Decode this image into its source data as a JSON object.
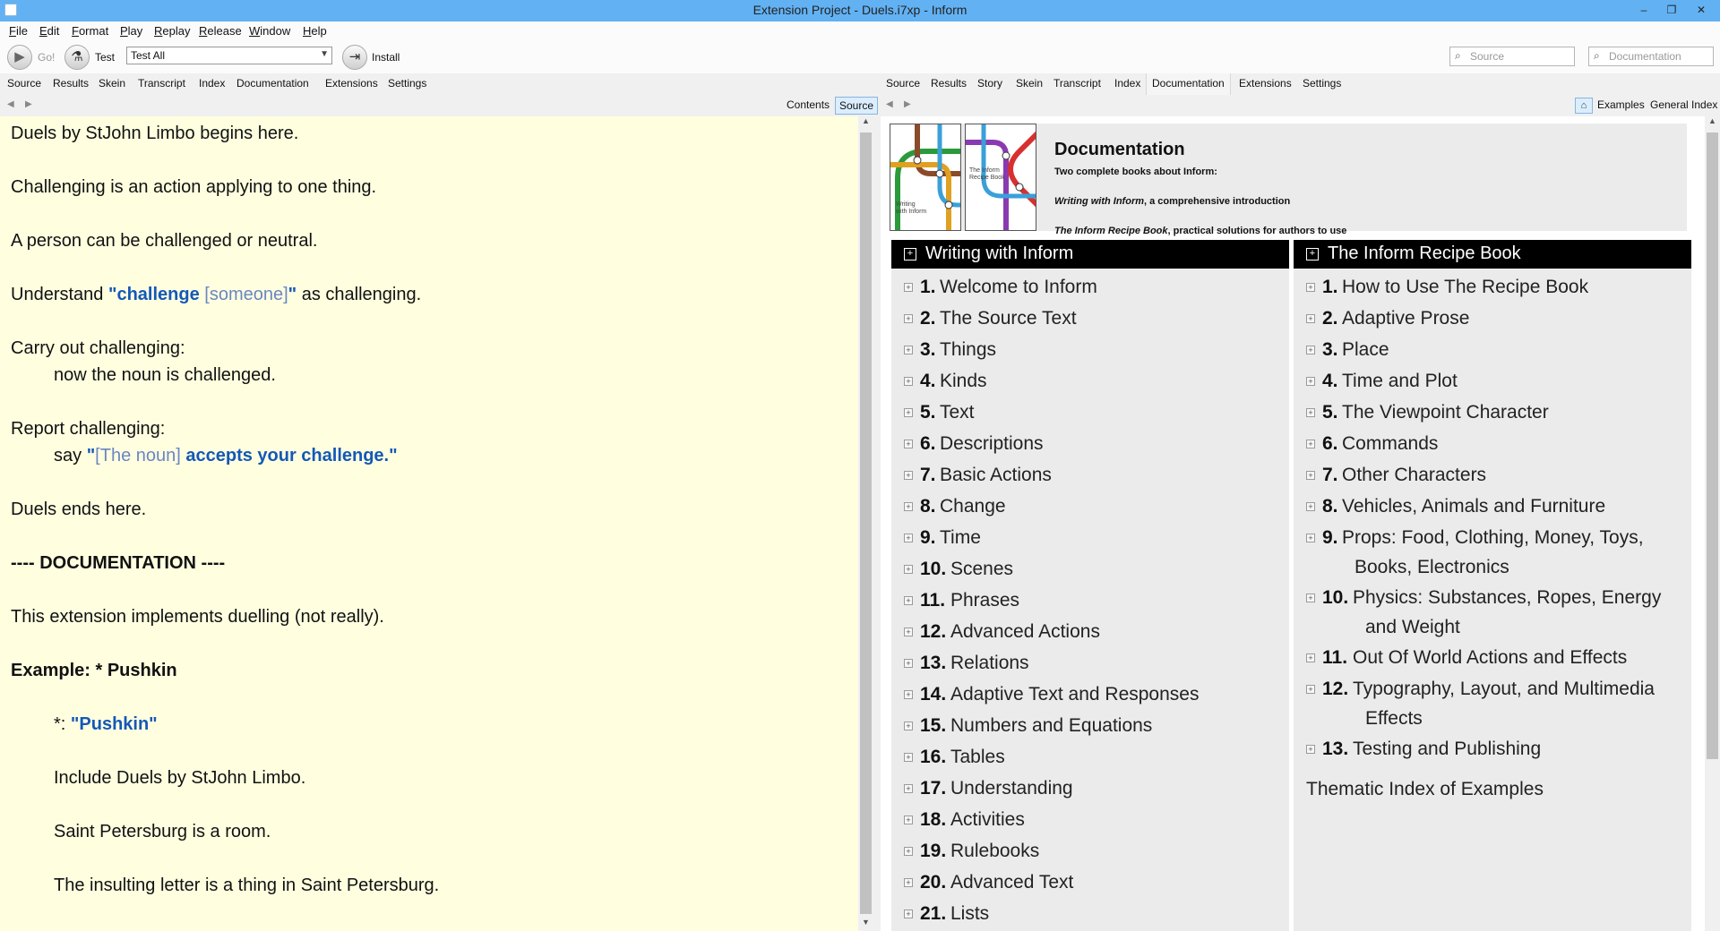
{
  "window": {
    "title": "Extension Project - Duels.i7xp - Inform",
    "minimize": "–",
    "restore": "❐",
    "close": "✕"
  },
  "menu": [
    {
      "u": "F",
      "rest": "ile"
    },
    {
      "u": "E",
      "rest": "dit"
    },
    {
      "u": "F",
      "rest": "ormat"
    },
    {
      "u": "P",
      "rest": "lay"
    },
    {
      "u": "R",
      "rest": "eplay"
    },
    {
      "u": "R",
      "rest": "elease"
    },
    {
      "u": "W",
      "rest": "indow"
    },
    {
      "u": "H",
      "rest": "elp"
    }
  ],
  "toolbar": {
    "go_label": "Go!",
    "test_label": "Test",
    "test_select": "Test All",
    "install_label": "Install",
    "source_search_placeholder": "Source",
    "doc_search_placeholder": "Documentation"
  },
  "left_tabs": [
    "Source",
    "Results",
    "Skein",
    "Transcript",
    "Index",
    "Documentation",
    "Extensions",
    "Settings"
  ],
  "right_tabs": [
    "Source",
    "Results",
    "Story",
    "Skein",
    "Transcript",
    "Index",
    "Documentation",
    "Extensions",
    "Settings"
  ],
  "left_nav": {
    "contents": "Contents",
    "source": "Source"
  },
  "right_nav": {
    "examples": "Examples",
    "general_index": "General Index"
  },
  "source": {
    "l1": "Duels by StJohn Limbo begins here.",
    "l2": "Challenging is an action applying to one thing.",
    "l3": "A person can be challenged or neutral.",
    "l4_a": "Understand ",
    "l4_b": "\"challenge ",
    "l4_c": "[someone]",
    "l4_d": "\"",
    "l4_e": " as challenging.",
    "l5": "Carry out challenging:",
    "l6": "now the noun is challenged.",
    "l7": "Report challenging:",
    "l8_a": "say ",
    "l8_b": "\"",
    "l8_c": "[The noun]",
    "l8_d": " accepts your challenge.\"",
    "l9": "Duels ends here.",
    "l10": "---- DOCUMENTATION ----",
    "l11": "This extension implements duelling (not really).",
    "l12": "Example: * Pushkin",
    "l13_a": "*: ",
    "l13_b": "\"Pushkin\"",
    "l14": "Include Duels by StJohn Limbo.",
    "l15": "Saint Petersburg is a room.",
    "l16": "The insulting letter is a thing in Saint Petersburg."
  },
  "doc": {
    "title": "Documentation",
    "cover1_caption_1": "Writing",
    "cover1_caption_2": "with Inform",
    "cover2_caption_1": "The Inform",
    "cover2_caption_2": "Recipe Book",
    "sub1": "Two complete books about Inform:",
    "sub2_a": "Writing with Inform",
    "sub2_b": ", a comprehensive introduction",
    "sub3_a": "The Inform Recipe Book",
    "sub3_b": ", practical solutions for authors to use",
    "wwi_title": "Writing with Inform",
    "wwi": [
      {
        "n": "1.",
        "t": "Welcome to Inform"
      },
      {
        "n": "2.",
        "t": "The Source Text"
      },
      {
        "n": "3.",
        "t": "Things"
      },
      {
        "n": "4.",
        "t": "Kinds"
      },
      {
        "n": "5.",
        "t": "Text"
      },
      {
        "n": "6.",
        "t": "Descriptions"
      },
      {
        "n": "7.",
        "t": "Basic Actions"
      },
      {
        "n": "8.",
        "t": "Change"
      },
      {
        "n": "9.",
        "t": "Time"
      },
      {
        "n": "10.",
        "t": "Scenes"
      },
      {
        "n": "11.",
        "t": "Phrases"
      },
      {
        "n": "12.",
        "t": "Advanced Actions"
      },
      {
        "n": "13.",
        "t": "Relations"
      },
      {
        "n": "14.",
        "t": "Adaptive Text and Responses"
      },
      {
        "n": "15.",
        "t": "Numbers and Equations"
      },
      {
        "n": "16.",
        "t": "Tables"
      },
      {
        "n": "17.",
        "t": "Understanding"
      },
      {
        "n": "18.",
        "t": "Activities"
      },
      {
        "n": "19.",
        "t": "Rulebooks"
      },
      {
        "n": "20.",
        "t": "Advanced Text"
      },
      {
        "n": "21.",
        "t": "Lists"
      }
    ],
    "rb_title": "The Inform Recipe Book",
    "rb": [
      {
        "n": "1.",
        "t": "How to Use The Recipe Book"
      },
      {
        "n": "2.",
        "t": "Adaptive Prose"
      },
      {
        "n": "3.",
        "t": "Place"
      },
      {
        "n": "4.",
        "t": "Time and Plot"
      },
      {
        "n": "5.",
        "t": "The Viewpoint Character"
      },
      {
        "n": "6.",
        "t": "Commands"
      },
      {
        "n": "7.",
        "t": "Other Characters"
      },
      {
        "n": "8.",
        "t": "Vehicles, Animals and Furniture"
      },
      {
        "n": "9.",
        "t": "Props: Food, Clothing, Money, Toys,",
        "t2": "Books, Electronics"
      },
      {
        "n": "10.",
        "t": "Physics: Substances, Ropes, Energy",
        "t2": "and Weight"
      },
      {
        "n": "11.",
        "t": "Out Of World Actions and Effects"
      },
      {
        "n": "12.",
        "t": "Typography, Layout, and Multimedia",
        "t2": "Effects"
      },
      {
        "n": "13.",
        "t": "Testing and Publishing"
      }
    ],
    "thematic": "Thematic Index of Examples"
  }
}
